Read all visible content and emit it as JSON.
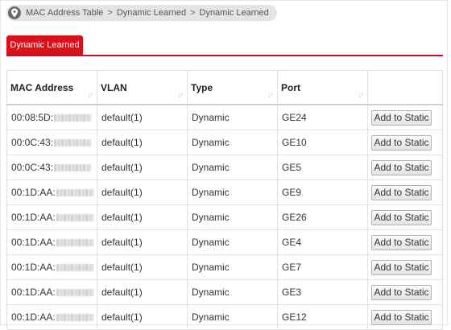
{
  "breadcrumb": {
    "items": [
      "MAC Address Table",
      "Dynamic Learned",
      "Dynamic Learned"
    ],
    "separator": ">"
  },
  "tabs": [
    {
      "label": "Dynamic Learned",
      "active": true
    }
  ],
  "table": {
    "columns": [
      "MAC Address",
      "VLAN",
      "Type",
      "Port",
      ""
    ],
    "sort_icon": "sort-icon",
    "action_label": "Add to Static",
    "rows": [
      {
        "mac_prefix": "00:08:5D:",
        "vlan": "default(1)",
        "type": "Dynamic",
        "port": "GE24"
      },
      {
        "mac_prefix": "00:0C:43:",
        "vlan": "default(1)",
        "type": "Dynamic",
        "port": "GE10"
      },
      {
        "mac_prefix": "00:0C:43:",
        "vlan": "default(1)",
        "type": "Dynamic",
        "port": "GE5"
      },
      {
        "mac_prefix": "00:1D:AA:",
        "vlan": "default(1)",
        "type": "Dynamic",
        "port": "GE9"
      },
      {
        "mac_prefix": "00:1D:AA:",
        "vlan": "default(1)",
        "type": "Dynamic",
        "port": "GE26"
      },
      {
        "mac_prefix": "00:1D:AA:",
        "vlan": "default(1)",
        "type": "Dynamic",
        "port": "GE4"
      },
      {
        "mac_prefix": "00:1D:AA:",
        "vlan": "default(1)",
        "type": "Dynamic",
        "port": "GE7"
      },
      {
        "mac_prefix": "00:1D:AA:",
        "vlan": "default(1)",
        "type": "Dynamic",
        "port": "GE3"
      },
      {
        "mac_prefix": "00:1D:AA:",
        "vlan": "default(1)",
        "type": "Dynamic",
        "port": "GE12"
      }
    ]
  },
  "colors": {
    "accent": "#d9111b",
    "header_rule": "#c8102e"
  }
}
